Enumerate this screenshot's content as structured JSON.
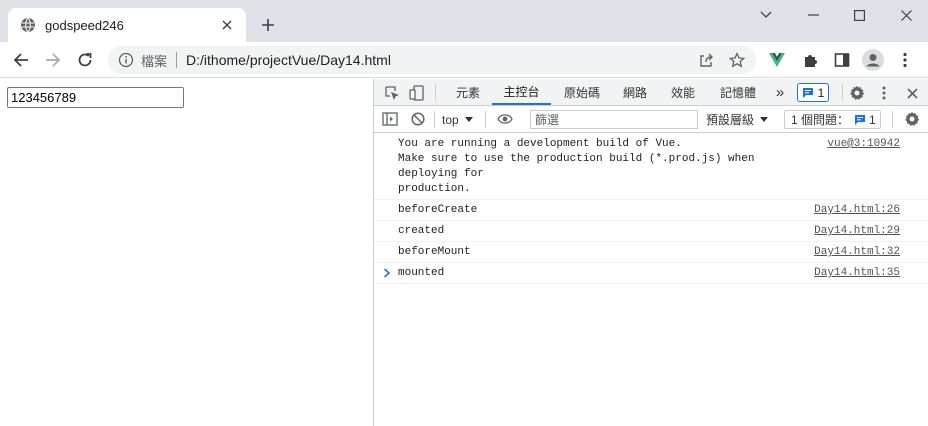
{
  "browser": {
    "tab_title": "godspeed246",
    "omnibox": {
      "security_label": "檔案",
      "url": "D:/ithome/projectVue/Day14.html"
    }
  },
  "page": {
    "input_value": "123456789"
  },
  "devtools": {
    "tabs": [
      {
        "label": "元素"
      },
      {
        "label": "主控台"
      },
      {
        "label": "原始碼"
      },
      {
        "label": "網路"
      },
      {
        "label": "效能"
      },
      {
        "label": "記憶體"
      }
    ],
    "more_tabs": "»",
    "message_count": "1",
    "context": "top",
    "filter_placeholder": "篩選",
    "levels_label": "預設層級",
    "issues_label": "1 個問題：",
    "issues_count": "1",
    "console": [
      {
        "text": "You are running a development build of Vue.\nMake sure to use the production build (*.prod.js) when deploying for\nproduction.",
        "source": "vue@3:10942"
      },
      {
        "text": "beforeCreate",
        "source": "Day14.html:26"
      },
      {
        "text": "created",
        "source": "Day14.html:29"
      },
      {
        "text": "beforeMount",
        "source": "Day14.html:32"
      },
      {
        "text": "mounted",
        "source": "Day14.html:35"
      }
    ],
    "prompt_symbol": "›"
  },
  "colors": {
    "accent": "#1a73e8",
    "vue_green": "#41b883",
    "vue_dark": "#34495e"
  }
}
